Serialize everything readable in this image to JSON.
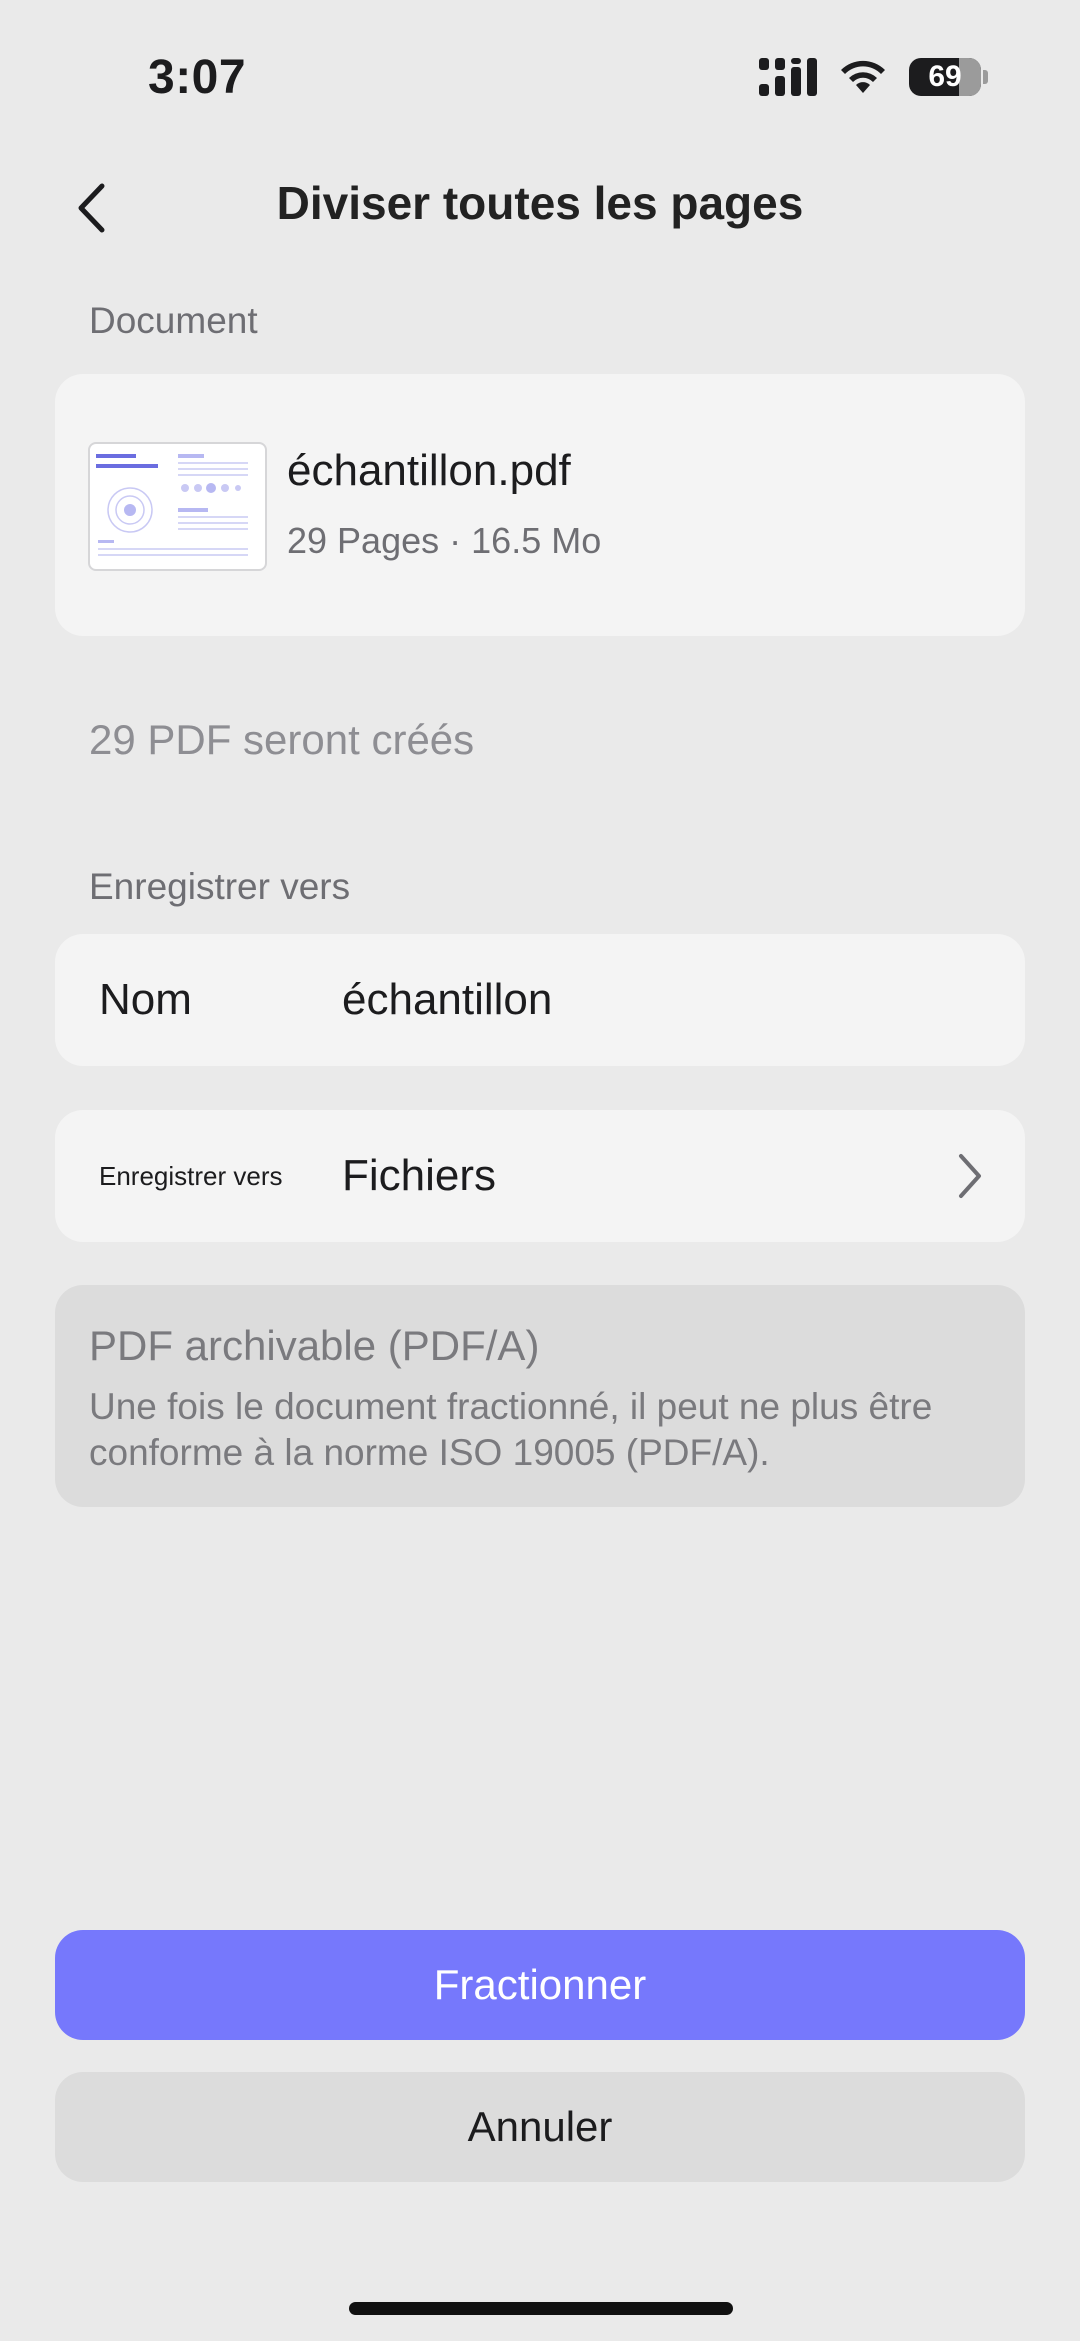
{
  "status_bar": {
    "time": "3:07",
    "battery": "69"
  },
  "header": {
    "title": "Diviser toutes les pages",
    "back_icon": "chevron-left-icon"
  },
  "document_section": {
    "label": "Document",
    "file_name": "échantillon.pdf",
    "pages": "29 Pages",
    "separator": "·",
    "size": "16.5 Mo"
  },
  "result_note": "29 PDF seront créés",
  "save_section": {
    "label": "Enregistrer vers",
    "name_row": {
      "label": "Nom",
      "value": "échantillon"
    },
    "location_row": {
      "label": "Enregistrer vers",
      "value": "Fichiers",
      "icon": "chevron-right-icon"
    }
  },
  "archive_notice": {
    "title": "PDF archivable (PDF/A)",
    "description": "Une fois le document fractionné, il peut ne plus être conforme à la norme ISO 19005 (PDF/A)."
  },
  "actions": {
    "primary": "Fractionner",
    "secondary": "Annuler"
  },
  "colors": {
    "accent": "#7678fc",
    "background": "#eaeaea",
    "card": "#f4f4f4"
  }
}
